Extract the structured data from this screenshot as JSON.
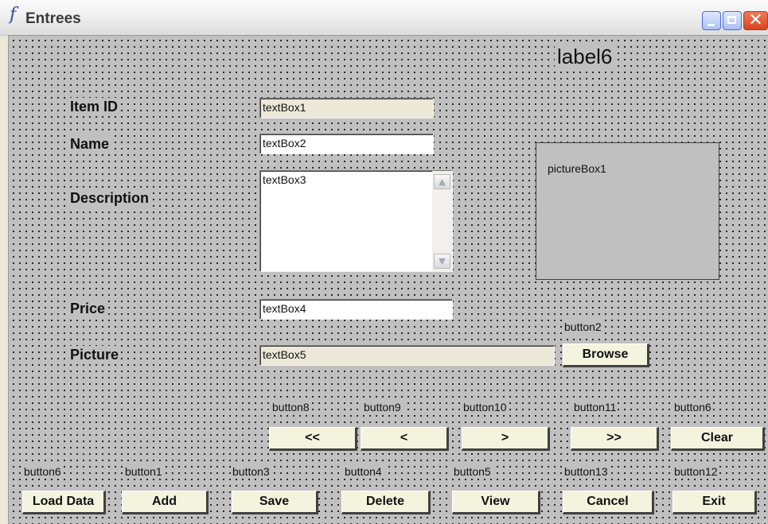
{
  "window": {
    "title": "Entrees",
    "app_icon": "f",
    "controls": {
      "minimize": "minimize-icon",
      "maximize": "maximize-icon",
      "close": "close-icon",
      "close_glyph": "✕"
    }
  },
  "header_label": "label6",
  "fields": {
    "item_id": {
      "label": "Item ID",
      "value": "textBox1"
    },
    "name": {
      "label": "Name",
      "value": "textBox2"
    },
    "description": {
      "label": "Description",
      "value": "textBox3"
    },
    "price": {
      "label": "Price",
      "value": "textBox4"
    },
    "picture": {
      "label": "Picture",
      "value": "textBox5"
    }
  },
  "picture_box": {
    "label": "pictureBox1"
  },
  "browse": {
    "caption": "button2",
    "label": "Browse"
  },
  "scrollbar": {
    "up_glyph": "▲",
    "down_glyph": "▼"
  },
  "nav_buttons": [
    {
      "caption": "button8",
      "label": "<<"
    },
    {
      "caption": "button9",
      "label": "<"
    },
    {
      "caption": "button10",
      "label": ">"
    },
    {
      "caption": "button11",
      "label": ">>"
    },
    {
      "caption": "button6",
      "label": "Clear"
    }
  ],
  "action_buttons": [
    {
      "caption": "button6",
      "label": "Load Data"
    },
    {
      "caption": "button1",
      "label": "Add"
    },
    {
      "caption": "button3",
      "label": "Save"
    },
    {
      "caption": "button4",
      "label": "Delete"
    },
    {
      "caption": "button5",
      "label": "View"
    },
    {
      "caption": "button13",
      "label": "Cancel"
    },
    {
      "caption": "button12",
      "label": "Exit"
    }
  ],
  "colors": {
    "form_background": "#c0c0c0",
    "button_face": "#f4f3de",
    "readonly_field": "#ece9d8",
    "close_button": "#d8431e"
  }
}
